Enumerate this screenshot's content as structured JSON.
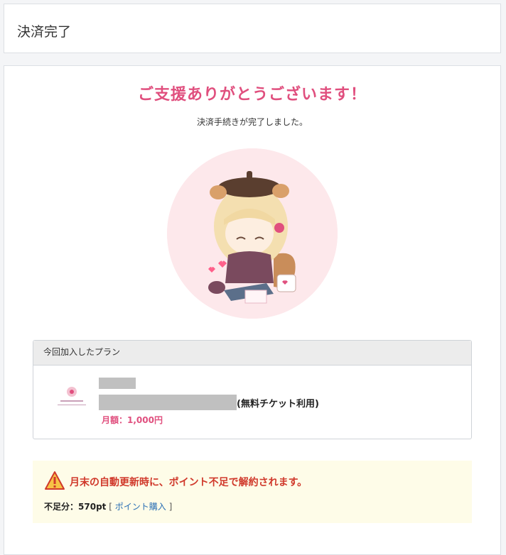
{
  "header": {
    "title": "決済完了"
  },
  "thanks": {
    "title": "ご支援ありがとうございます！",
    "subtitle": "決済手続きが完了しました。"
  },
  "illustration": {
    "icon": "mascot-character-illustration",
    "bg_color": "#fde8eb"
  },
  "plan": {
    "heading": "今回加入したプラン",
    "logo": "creator-logo-image",
    "ticket_note": "(無料チケット利用)",
    "price": "月額：1,000円"
  },
  "warning": {
    "icon": "warning-icon",
    "message": "月末の自動更新時に、ポイント不足で解約されます。",
    "shortage_label": "不足分：",
    "shortage_value": "570pt",
    "bracket_open": "[",
    "buy_link": "ポイント購入",
    "bracket_close": "]"
  },
  "colors": {
    "accent": "#e04f7e",
    "warning_text": "#d0392b",
    "link": "#2a6fb5",
    "warning_bg": "#fefce8"
  }
}
